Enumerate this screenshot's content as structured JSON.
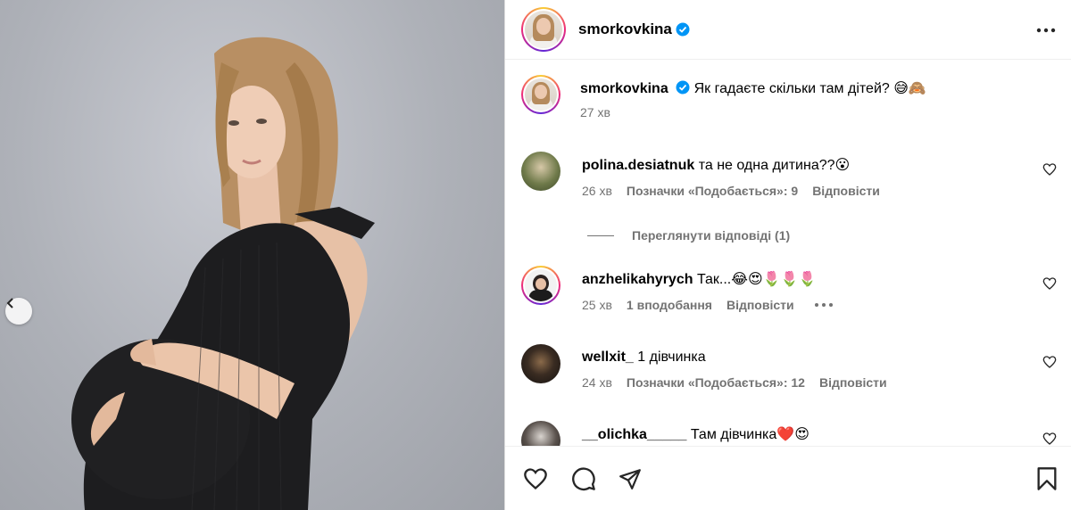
{
  "header": {
    "username": "smorkovkina"
  },
  "caption": {
    "username": "smorkovkina",
    "text": "Як гадаєте скільки там дітей?",
    "emoji": "😅🙈",
    "time": "27 хв"
  },
  "comments": [
    {
      "username": "polina.desiatnuk",
      "text": "та не одна дитина??",
      "emoji": "😮",
      "time": "26 хв",
      "likes": "Позначки «Подобається»: 9",
      "reply": "Відповісти"
    },
    {
      "username": "anzhelikahyrych",
      "text": "Так...",
      "emoji": "😂😍🌷🌷🌷",
      "time": "25 хв",
      "likes": "1 вподобання",
      "reply": "Відповісти"
    },
    {
      "username": "wellxit_",
      "text": "1 дівчинка",
      "emoji": "",
      "time": "24 хв",
      "likes": "Позначки «Подобається»: 12",
      "reply": "Відповісти"
    },
    {
      "username": "__olichka_____",
      "text": "Там дівчинка",
      "emoji": "❤️😍",
      "time": "",
      "likes": "",
      "reply": ""
    }
  ],
  "view_replies": "Переглянути відповіді (1)",
  "icons": {
    "verified": "verified-badge-icon",
    "more": "more-options-icon",
    "like": "heart-icon",
    "comment": "comment-icon",
    "share": "share-icon",
    "save": "bookmark-icon",
    "prev": "chevron-left-icon"
  },
  "colors": {
    "verified": "#0095f6",
    "muted": "#737373",
    "border": "#dbdbdb"
  }
}
